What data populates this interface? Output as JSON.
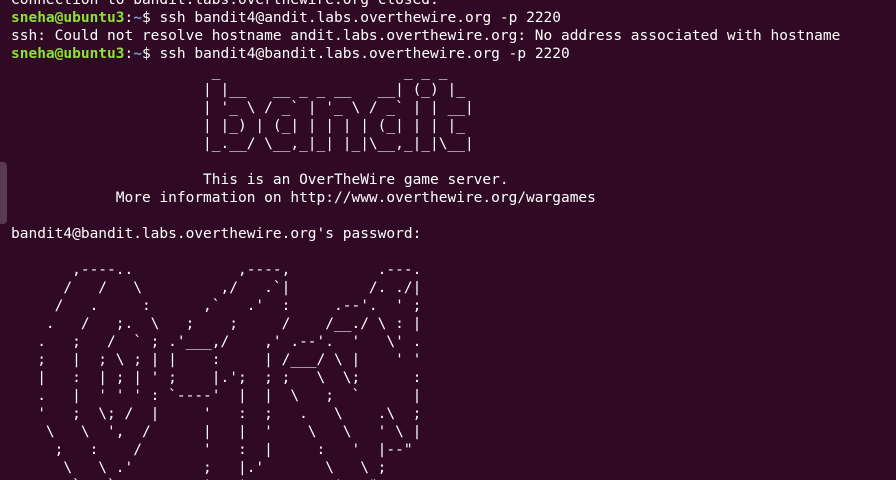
{
  "terminal": {
    "line0": "Connection to bandit.labs.overthewire.org closed.",
    "prompt_user": "sneha@ubuntu3",
    "prompt_path": "~",
    "prompt_symbol": "$ ",
    "cmd1": "ssh bandit4@andit.labs.overthewire.org -p 2220",
    "error_line": "ssh: Could not resolve hostname andit.labs.overthewire.org: No address associated with hostname",
    "cmd2": "ssh bandit4@bandit.labs.overthewire.org -p 2220",
    "bandit_art": "                       _                     _ _ _\n                      | |__   __ _ _ __   __| (_) |_\n                      | '_ \\ / _` | '_ \\ / _` | | __|\n                      | |_) | (_| | | | | (_| | | |_\n                      |_.__/ \\__,_|_| |_|\\__,_|_|\\__|",
    "welcome_line": "                      This is an OverTheWire game server.",
    "info_line": "            More information on http://www.overthewire.org/wargames",
    "password_prompt": "bandit4@bandit.labs.overthewire.org's password:",
    "otw_art": "       ,----..            ,----,          .---.\n      /   /   \\         ,/   .`|         /. ./|\n     /   .     :      ,`   .'  :     .--'.  ' ;\n    .   /   ;.  \\   ;    ;     /    /__./ \\ : |\n   .   ;   /  ` ; .'___,/    ,' .--'.  '   \\' .\n   ;   |  ; \\ ; | |    :     | /___/ \\ |    ' '\n   |   :  | ; | ' ;    |.';  ; ;   \\  \\;      :\n   .   |  ' ' ' : `----'  |  |  \\   ;  `      |\n   '   ;  \\; /  |     '   :  ;   .   \\    .\\  ;\n    \\   \\  ',  /      |   |  '    \\   \\   ' \\ |\n     ;   :    /       '   :  |     :   '  |--\"\n      \\   \\ .'        ;   |.'       \\   \\ ;\n       `---`          '---'          '---\""
  },
  "colors": {
    "background": "#300a24",
    "user": "#8ae234",
    "path": "#729fcf",
    "text": "#ffffff"
  }
}
